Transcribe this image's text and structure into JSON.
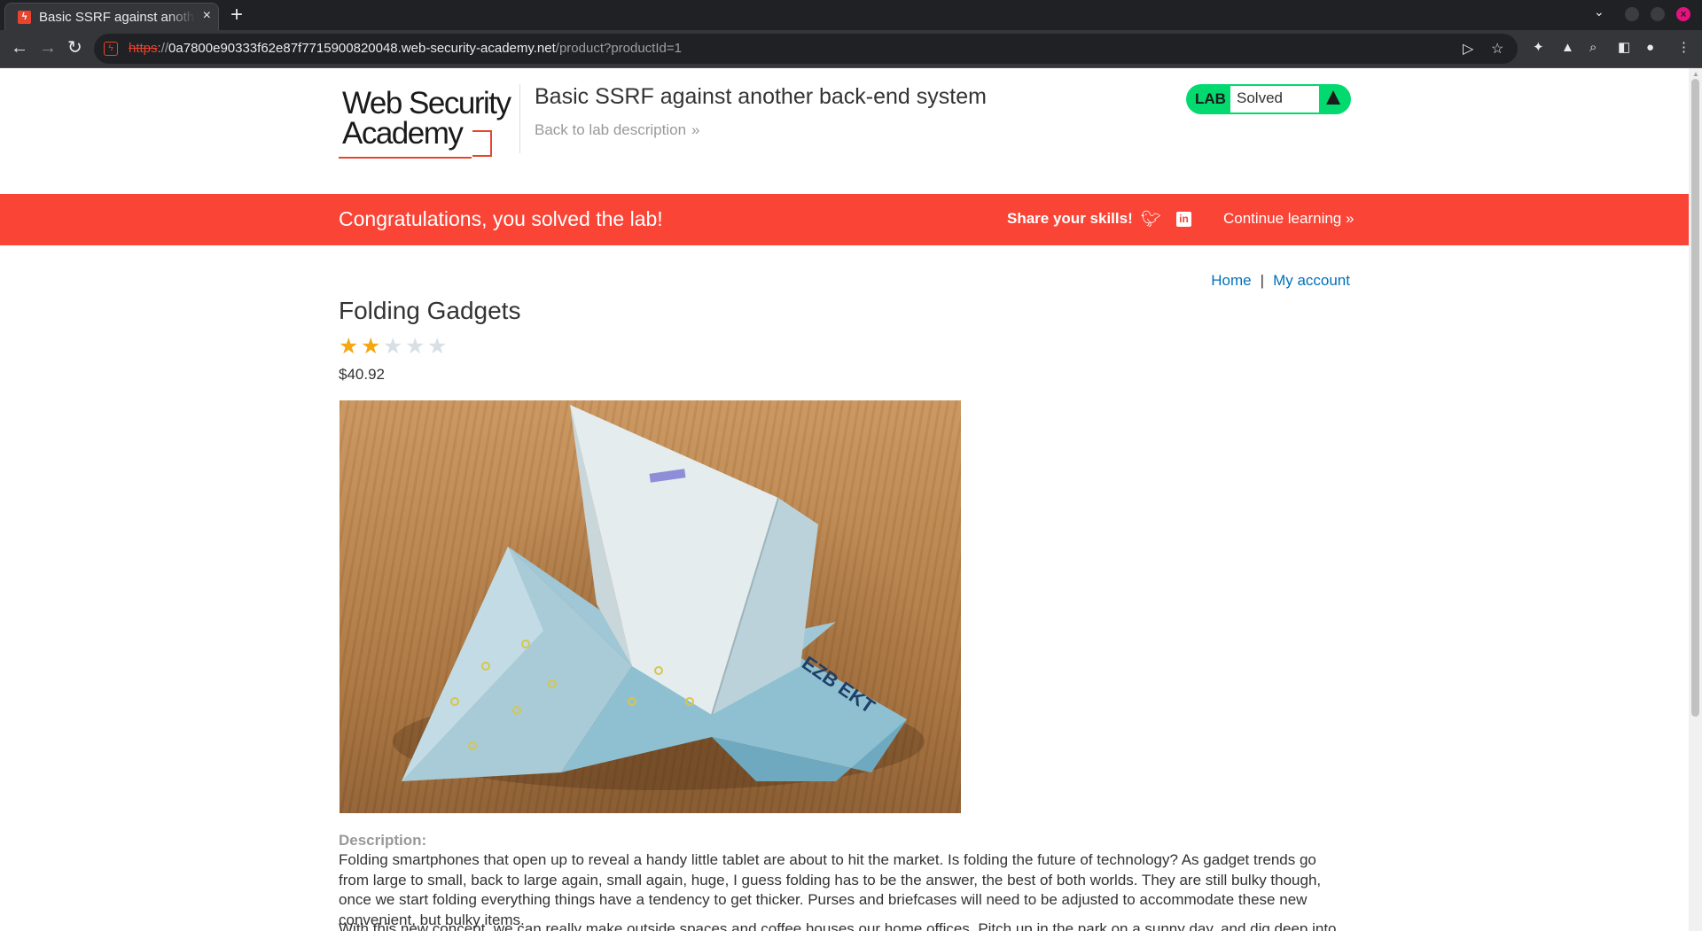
{
  "browser": {
    "tab_title": "Basic SSRF against another back-end system",
    "favicon_glyph": "ϟ",
    "new_tab_glyph": "+",
    "close_glyph": "×",
    "url_scheme": "https",
    "url_separator": "://",
    "url_host": "0a7800e90333f62e87f7715900820048.web-security-academy.net",
    "url_path": "/product?productId=1",
    "icons": [
      "back-icon",
      "forward-icon",
      "reload-icon",
      "send-icon",
      "bookmark-star-icon",
      "extensions-icon",
      "labs-icon",
      "search-icon",
      "sidebar-icon",
      "profile-icon",
      "menu-icon"
    ]
  },
  "header": {
    "logo_line1": "Web Security",
    "logo_line2": "Academy",
    "lab_title": "Basic SSRF against another back-end system",
    "back_link": "Back to lab description",
    "back_chevron": "»",
    "lab_badge": "LAB",
    "lab_status": "Solved"
  },
  "banner": {
    "congrats": "Congratulations, you solved the lab!",
    "share": "Share your skills!",
    "linkedin_glyph": "in",
    "continue": "Continue learning",
    "continue_chevron": "»"
  },
  "nav": {
    "home": "Home",
    "separator": "|",
    "account": "My account"
  },
  "product": {
    "title": "Folding Gadgets",
    "rating": 2,
    "rating_max": 5,
    "price": "$40.92",
    "image_subject": "origami-folded-banknote-bird",
    "description_label": "Description:",
    "description_p1": "Folding smartphones that open up to reveal a handy little tablet are about to hit the market. Is folding the future of technology? As gadget trends go from large to small, back to large again, small again, huge, I guess folding has to be the answer, the best of both worlds. They are still bulky though, once we start folding everything things have a tendency to get thicker. Purses and briefcases will need to be adjusted to accommodate these new convenient, but bulky items.",
    "description_p2": "With this new concept, we can really make outside spaces and coffee houses our home offices. Pitch up in the park on a sunny day, and dig deep into your"
  },
  "colors": {
    "accent_red": "#fa4436",
    "lab_green": "#02d96e",
    "link_blue": "#0071bc",
    "star_gold": "#f3a811"
  }
}
